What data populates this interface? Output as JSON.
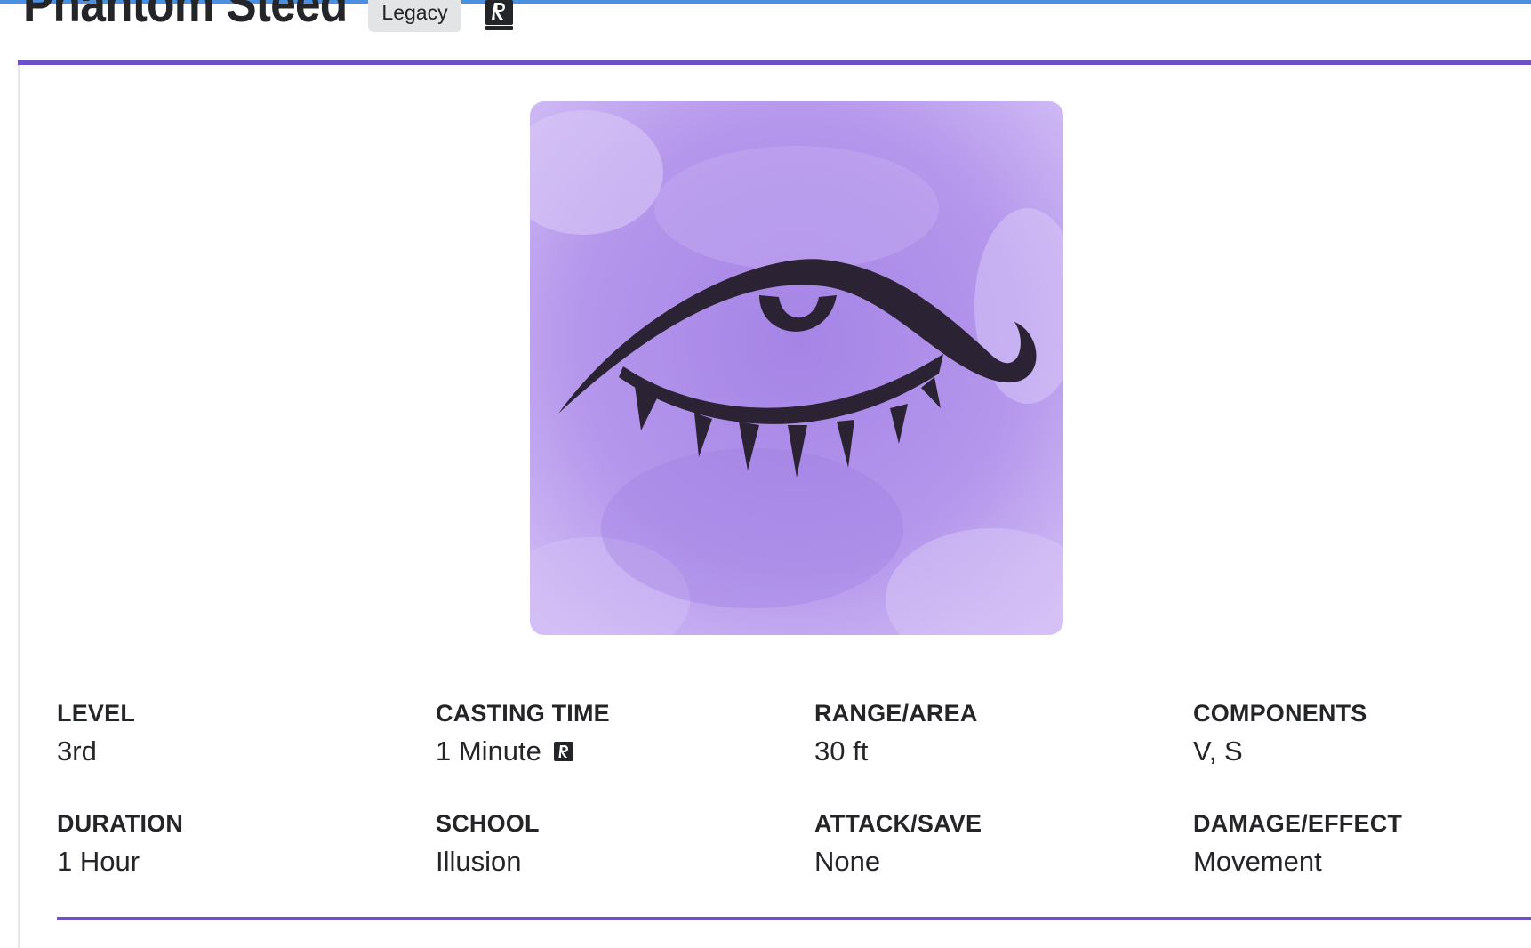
{
  "spell": {
    "name": "Phantom Steed",
    "badge": "Legacy",
    "source_icon": "book-icon",
    "image_icon": "eye-illusion-icon"
  },
  "stats": {
    "level": {
      "label": "LEVEL",
      "value": "3rd"
    },
    "casting_time": {
      "label": "CASTING TIME",
      "value": "1 Minute",
      "icon": "ritual-icon"
    },
    "range": {
      "label": "RANGE/AREA",
      "value": "30 ft"
    },
    "components": {
      "label": "COMPONENTS",
      "value": "V, S"
    },
    "duration": {
      "label": "DURATION",
      "value": "1 Hour"
    },
    "school": {
      "label": "SCHOOL",
      "value": "Illusion"
    },
    "attack_save": {
      "label": "ATTACK/SAVE",
      "value": "None"
    },
    "damage_effect": {
      "label": "DAMAGE/EFFECT",
      "value": "Movement"
    }
  },
  "colors": {
    "accent": "#6b51c8",
    "image_bg": "#b293ea",
    "badge_bg": "#e3e4e6",
    "text": "#242528"
  }
}
